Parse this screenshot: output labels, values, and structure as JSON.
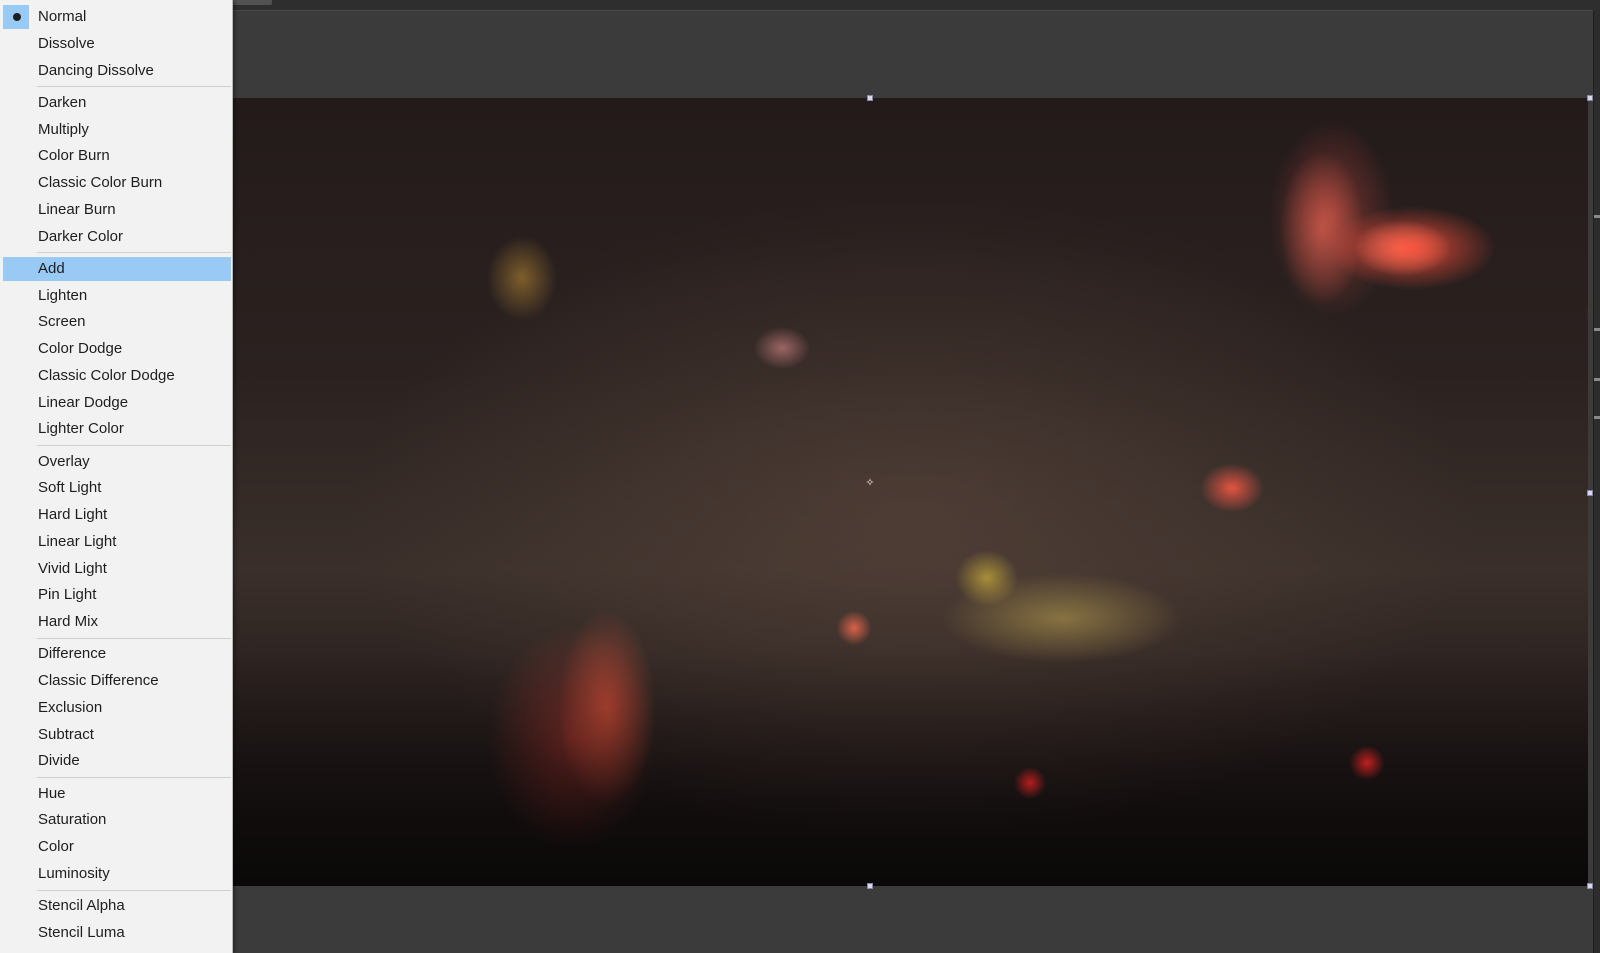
{
  "blend_mode_menu": {
    "selected": "Normal",
    "highlighted": "Add",
    "groups": [
      [
        "Normal",
        "Dissolve",
        "Dancing Dissolve"
      ],
      [
        "Darken",
        "Multiply",
        "Color Burn",
        "Classic Color Burn",
        "Linear Burn",
        "Darker Color"
      ],
      [
        "Add",
        "Lighten",
        "Screen",
        "Color Dodge",
        "Classic Color Dodge",
        "Linear Dodge",
        "Lighter Color"
      ],
      [
        "Overlay",
        "Soft Light",
        "Hard Light",
        "Linear Light",
        "Vivid Light",
        "Pin Light",
        "Hard Mix"
      ],
      [
        "Difference",
        "Classic Difference",
        "Exclusion",
        "Subtract",
        "Divide"
      ],
      [
        "Hue",
        "Saturation",
        "Color",
        "Luminosity"
      ],
      [
        "Stencil Alpha",
        "Stencil Luma"
      ]
    ]
  },
  "viewer": {
    "content_icon": "crosshair-icon",
    "anchor_glyph": "✧"
  },
  "colors": {
    "menu_background": "#f2f2f2",
    "menu_highlight": "#99c9f5",
    "panel_background": "#3b3b3b"
  }
}
